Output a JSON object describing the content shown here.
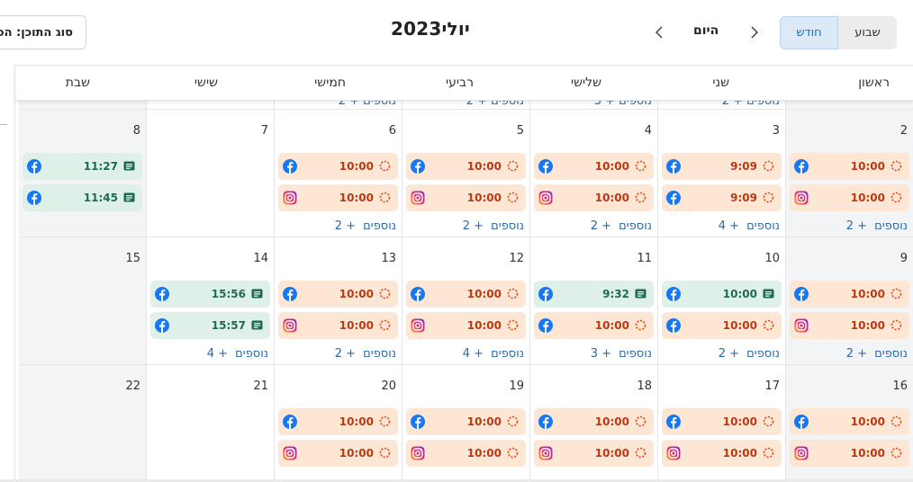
{
  "header": {
    "content_type_filter": "סוג התוכן: הכ",
    "title_month": "יולי",
    "title_year": "2023",
    "today_label": "היום",
    "view_week": "שבוע",
    "view_month": "חודש",
    "active_view": "month"
  },
  "weekdays": [
    "ראשון",
    "שני",
    "שלישי",
    "רביעי",
    "חמישי",
    "שישי",
    "שבת"
  ],
  "more_word": "נוספים",
  "prev_week_more": [
    {
      "col": 1,
      "count": "+ 2"
    },
    {
      "col": 2,
      "count": "+ 3"
    },
    {
      "col": 3,
      "count": "+ 2"
    },
    {
      "col": 4,
      "count": "+ 2"
    }
  ],
  "weeks": [
    {
      "days": [
        {
          "num": "2",
          "events": [
            {
              "platform": "facebook",
              "time": "10:00",
              "kind": "scheduled"
            },
            {
              "platform": "instagram",
              "time": "10:00",
              "kind": "scheduled"
            }
          ],
          "more": "+ 2"
        },
        {
          "num": "3",
          "events": [
            {
              "platform": "facebook",
              "time": "9:09",
              "kind": "scheduled"
            },
            {
              "platform": "facebook",
              "time": "9:09",
              "kind": "scheduled"
            }
          ],
          "more": "+ 4"
        },
        {
          "num": "4",
          "events": [
            {
              "platform": "facebook",
              "time": "10:00",
              "kind": "scheduled"
            },
            {
              "platform": "instagram",
              "time": "10:00",
              "kind": "scheduled"
            }
          ],
          "more": "+ 2"
        },
        {
          "num": "5",
          "events": [
            {
              "platform": "facebook",
              "time": "10:00",
              "kind": "scheduled"
            },
            {
              "platform": "instagram",
              "time": "10:00",
              "kind": "scheduled"
            }
          ],
          "more": "+ 2"
        },
        {
          "num": "6",
          "events": [
            {
              "platform": "facebook",
              "time": "10:00",
              "kind": "scheduled"
            },
            {
              "platform": "instagram",
              "time": "10:00",
              "kind": "scheduled"
            }
          ],
          "more": "+ 2"
        },
        {
          "num": "7",
          "events": [],
          "more": ""
        },
        {
          "num": "8",
          "events": [
            {
              "platform": "facebook",
              "time": "11:27",
              "kind": "published"
            },
            {
              "platform": "facebook",
              "time": "11:45",
              "kind": "published"
            }
          ],
          "more": ""
        }
      ]
    },
    {
      "days": [
        {
          "num": "9",
          "events": [
            {
              "platform": "facebook",
              "time": "10:00",
              "kind": "scheduled"
            },
            {
              "platform": "instagram",
              "time": "10:00",
              "kind": "scheduled"
            }
          ],
          "more": "+ 2"
        },
        {
          "num": "10",
          "events": [
            {
              "platform": "facebook",
              "time": "10:00",
              "kind": "published"
            },
            {
              "platform": "facebook",
              "time": "10:00",
              "kind": "scheduled"
            }
          ],
          "more": "+ 2"
        },
        {
          "num": "11",
          "events": [
            {
              "platform": "facebook",
              "time": "9:32",
              "kind": "published"
            },
            {
              "platform": "facebook",
              "time": "10:00",
              "kind": "scheduled"
            }
          ],
          "more": "+ 3"
        },
        {
          "num": "12",
          "events": [
            {
              "platform": "facebook",
              "time": "10:00",
              "kind": "scheduled"
            },
            {
              "platform": "instagram",
              "time": "10:00",
              "kind": "scheduled"
            }
          ],
          "more": "+ 4"
        },
        {
          "num": "13",
          "events": [
            {
              "platform": "facebook",
              "time": "10:00",
              "kind": "scheduled"
            },
            {
              "platform": "instagram",
              "time": "10:00",
              "kind": "scheduled"
            }
          ],
          "more": "+ 2"
        },
        {
          "num": "14",
          "events": [
            {
              "platform": "facebook",
              "time": "15:56",
              "kind": "published"
            },
            {
              "platform": "facebook",
              "time": "15:57",
              "kind": "published"
            }
          ],
          "more": "+ 4"
        },
        {
          "num": "15",
          "events": [],
          "more": ""
        }
      ]
    },
    {
      "days": [
        {
          "num": "16",
          "events": [
            {
              "platform": "facebook",
              "time": "10:00",
              "kind": "scheduled"
            },
            {
              "platform": "instagram",
              "time": "10:00",
              "kind": "scheduled"
            }
          ],
          "more": ""
        },
        {
          "num": "17",
          "events": [
            {
              "platform": "facebook",
              "time": "10:00",
              "kind": "scheduled"
            },
            {
              "platform": "instagram",
              "time": "10:00",
              "kind": "scheduled"
            }
          ],
          "more": ""
        },
        {
          "num": "18",
          "events": [
            {
              "platform": "facebook",
              "time": "10:00",
              "kind": "scheduled"
            },
            {
              "platform": "instagram",
              "time": "10:00",
              "kind": "scheduled"
            }
          ],
          "more": ""
        },
        {
          "num": "19",
          "events": [
            {
              "platform": "facebook",
              "time": "10:00",
              "kind": "scheduled"
            },
            {
              "platform": "instagram",
              "time": "10:00",
              "kind": "scheduled"
            }
          ],
          "more": ""
        },
        {
          "num": "20",
          "events": [
            {
              "platform": "facebook",
              "time": "10:00",
              "kind": "scheduled"
            },
            {
              "platform": "instagram",
              "time": "10:00",
              "kind": "scheduled"
            }
          ],
          "more": ""
        },
        {
          "num": "21",
          "events": [],
          "more": ""
        },
        {
          "num": "22",
          "events": [],
          "more": ""
        }
      ]
    }
  ],
  "colors": {
    "scheduled_bg": "#fde6d4",
    "scheduled_text": "#b73a15",
    "published_bg": "#dff0e9",
    "published_text": "#1d6b54",
    "facebook": "#1877f2",
    "link": "#2a6aa8",
    "weekend_bg": "#f2f4f6"
  }
}
